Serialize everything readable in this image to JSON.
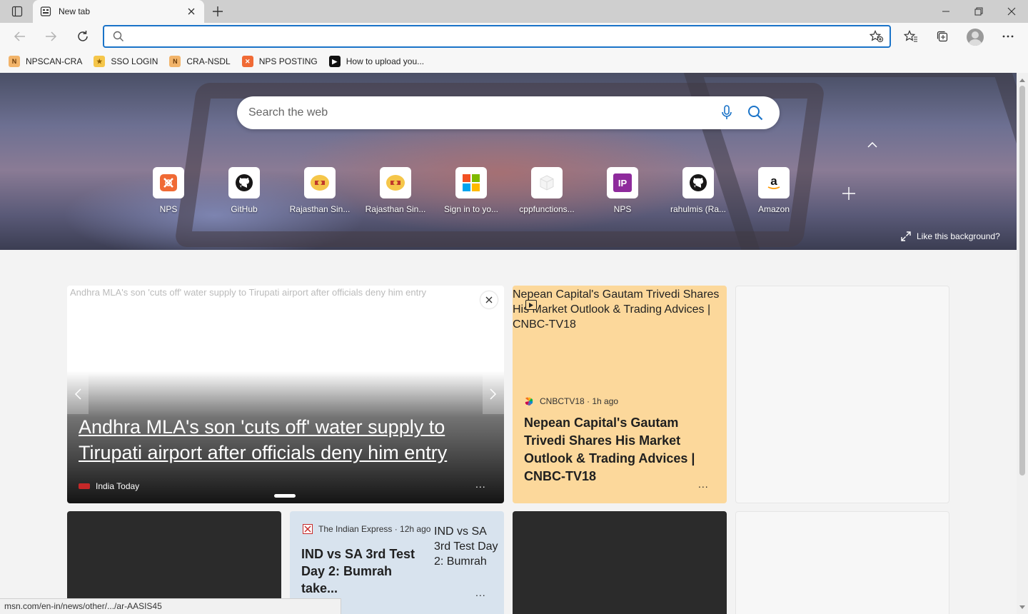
{
  "browser": {
    "tab": {
      "title": "New tab"
    },
    "address": {
      "value": "",
      "placeholder": ""
    }
  },
  "favorites": [
    {
      "label": "NPSCAN-CRA",
      "icon": "nps-icon",
      "color": "#b5651d"
    },
    {
      "label": "SSO LOGIN",
      "icon": "rajasthan-emblem-icon",
      "color": "#e0a000"
    },
    {
      "label": "CRA-NSDL",
      "icon": "nps-icon",
      "color": "#b5651d"
    },
    {
      "label": "NPS POSTING",
      "icon": "xampp-icon",
      "color": "#f06a35"
    },
    {
      "label": "How to upload you...",
      "icon": "video-icon",
      "color": "#111111"
    }
  ],
  "newtab": {
    "search_placeholder": "Search the web",
    "tiles": [
      {
        "label": "NPS",
        "icon": "xampp-icon",
        "color": "#f06a35"
      },
      {
        "label": "GitHub",
        "icon": "github-icon",
        "color": "#181717"
      },
      {
        "label": "Rajasthan Sin...",
        "icon": "rajasthan-emblem-icon",
        "color": "#e0a000"
      },
      {
        "label": "Rajasthan Sin...",
        "icon": "rajasthan-emblem-icon",
        "color": "#e0a000"
      },
      {
        "label": "Sign in to yo...",
        "icon": "microsoft-icon",
        "color": "#f25022"
      },
      {
        "label": "cppfunctions...",
        "icon": "box-icon",
        "color": "#dddddd"
      },
      {
        "label": "NPS",
        "icon": "ip-icon",
        "color": "#8e2b9c"
      },
      {
        "label": "rahulmis (Ra...",
        "icon": "github-icon",
        "color": "#181717"
      },
      {
        "label": "Amazon",
        "icon": "amazon-icon",
        "color": "#111111"
      }
    ],
    "like_background": "Like this background?"
  },
  "feed": {
    "hero": {
      "image_alt": "Andhra MLA's son 'cuts off' water supply to Tirupati airport after officials deny him entry",
      "title": "Andhra MLA's son 'cuts off' water supply to Tirupati airport after officials deny him entry",
      "source": "India Today",
      "more": "..."
    },
    "card2": {
      "image_alt": "Nepean Capital's Gautam Trivedi Shares His Market Outlook & Trading Advices | CNBC-TV18",
      "source": "CNBCTV18 · 1h ago",
      "title": "Nepean Capital's Gautam Trivedi Shares His Market Outlook & Trading Advices | CNBC-TV18",
      "more": "..."
    },
    "card5": {
      "source": "The Indian Express · 12h ago",
      "title": "IND vs SA 3rd Test Day 2: Bumrah take...",
      "image_alt": "IND vs SA 3rd Test Day 2: Bumrah",
      "more": "..."
    }
  },
  "status_url": "msn.com/en-in/news/other/.../ar-AASIS45"
}
